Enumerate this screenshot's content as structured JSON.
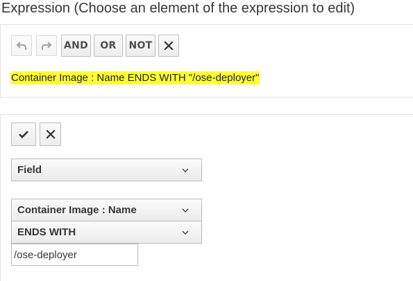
{
  "header": {
    "title": "Expression (Choose an element of the expression to edit)"
  },
  "toolbar": {
    "undo_icon": "undo-icon",
    "redo_icon": "redo-icon",
    "and_label": "AND",
    "or_label": "OR",
    "not_label": "NOT",
    "remove_icon": "close-icon"
  },
  "expression": {
    "text": "Container Image : Name ENDS WITH \"/ose-deployer\"",
    "highlight_color": "#ffff33"
  },
  "editor": {
    "commit_icon": "checkmark-icon",
    "discard_icon": "close-icon",
    "type_select": "Field",
    "field_select": "Container Image : Name",
    "operator_select": "ENDS WITH",
    "value_input": "/ose-deployer"
  }
}
